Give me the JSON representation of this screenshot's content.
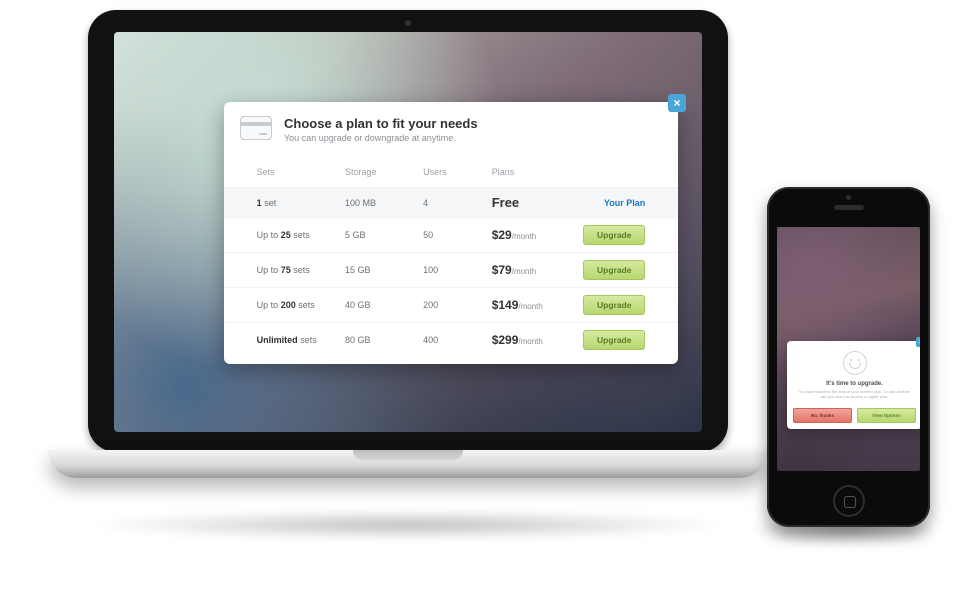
{
  "laptop": {
    "modal": {
      "title": "Choose a plan to fit your needs",
      "subtitle": "You can upgrade or downgrade at anytime.",
      "columns": {
        "sets": "Sets",
        "storage": "Storage",
        "users": "Users",
        "plans": "Plans"
      },
      "current_label": "Your Plan",
      "upgrade_label": "Upgrade",
      "month_suffix": "/month",
      "rows": [
        {
          "sets_prefix": "",
          "sets_qty": "1",
          "sets_suffix": " set",
          "storage": "100 MB",
          "users": "4",
          "price": "Free",
          "is_current": true
        },
        {
          "sets_prefix": "Up to ",
          "sets_qty": "25",
          "sets_suffix": " sets",
          "storage": "5 GB",
          "users": "50",
          "price": "$29",
          "is_current": false
        },
        {
          "sets_prefix": "Up to ",
          "sets_qty": "75",
          "sets_suffix": " sets",
          "storage": "15 GB",
          "users": "100",
          "price": "$79",
          "is_current": false
        },
        {
          "sets_prefix": "Up to ",
          "sets_qty": "200",
          "sets_suffix": " sets",
          "storage": "40 GB",
          "users": "200",
          "price": "$149",
          "is_current": false
        },
        {
          "sets_prefix": "",
          "sets_qty": "Unlimited",
          "sets_suffix": " sets",
          "storage": "80 GB",
          "users": "400",
          "price": "$299",
          "is_current": false
        }
      ]
    }
  },
  "phone": {
    "modal": {
      "title": "It's time to upgrade.",
      "subtitle": "You have reached the limit of your current plan. To add another set, you need to choose a higher plan.",
      "no_label": "No, thanks",
      "yes_label": "View Options"
    }
  },
  "close_glyph": "×"
}
